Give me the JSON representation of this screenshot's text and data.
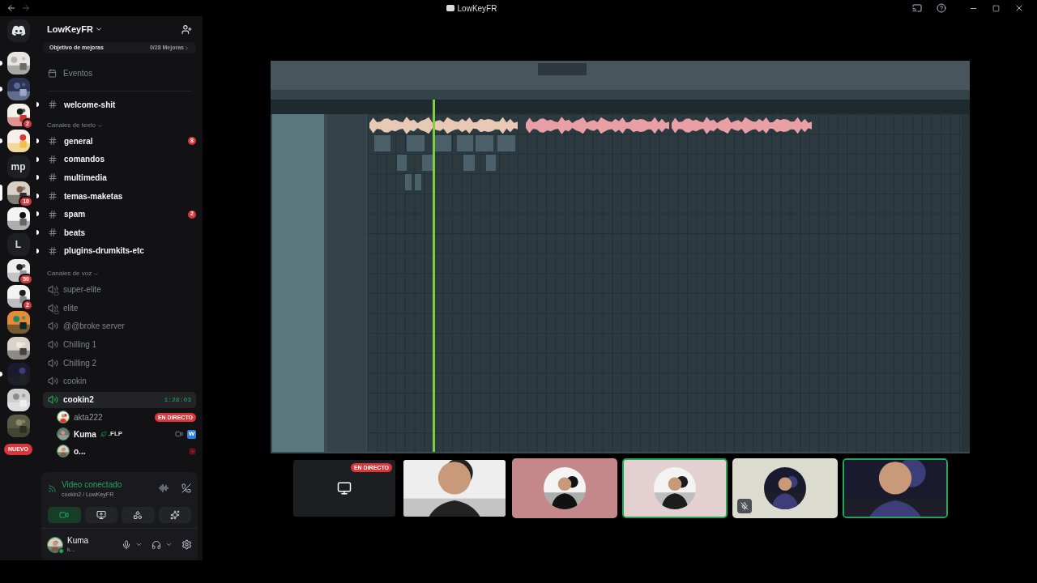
{
  "titlebar": {
    "title": "LowKeyFR"
  },
  "servers": [
    {
      "kind": "picture",
      "unread": true,
      "selected": false
    },
    {
      "kind": "picture",
      "unread": true,
      "selected": false
    },
    {
      "kind": "picture",
      "unread": false,
      "selected": false,
      "badge": "2"
    },
    {
      "kind": "picture",
      "unread": true,
      "selected": false
    },
    {
      "kind": "text",
      "label": "mp",
      "unread": false,
      "selected": false
    },
    {
      "kind": "picture",
      "unread": false,
      "selected": true,
      "badge": "10"
    },
    {
      "kind": "picture",
      "unread": false,
      "selected": false
    },
    {
      "kind": "text",
      "label": "L",
      "unread": false,
      "selected": false
    },
    {
      "kind": "picture",
      "unread": false,
      "selected": false,
      "badge": "50"
    },
    {
      "kind": "picture",
      "unread": false,
      "selected": false,
      "badge": "2"
    },
    {
      "kind": "picture",
      "unread": false,
      "selected": false
    },
    {
      "kind": "picture",
      "unread": false,
      "selected": false
    },
    {
      "kind": "picture",
      "unread": true,
      "selected": false
    },
    {
      "kind": "picture",
      "unread": false,
      "selected": false
    },
    {
      "kind": "picture",
      "unread": false,
      "selected": false
    }
  ],
  "new_badge": "NUEVO",
  "server": {
    "name": "LowKeyFR",
    "boost_label": "Objetivo de mejoras",
    "boost_progress": "0/28 Mejoras"
  },
  "events": "Eventos",
  "top_channels": [
    {
      "name": "welcome-shit",
      "unread": true
    }
  ],
  "categories": [
    {
      "name": "Canales de texto",
      "kind": "text",
      "channels": [
        {
          "name": "general",
          "unread": true,
          "badge": "8"
        },
        {
          "name": "comandos",
          "unread": true
        },
        {
          "name": "multimedia",
          "unread": true
        },
        {
          "name": "temas-maketas",
          "unread": true
        },
        {
          "name": "spam",
          "unread": true,
          "badge": "2"
        },
        {
          "name": "beats",
          "unread": true
        },
        {
          "name": "plugins-drumkits-etc",
          "unread": true
        }
      ]
    },
    {
      "name": "Canales de voz",
      "kind": "voice",
      "channels": [
        {
          "name": "super-elite",
          "selected": false,
          "locked": true
        },
        {
          "name": "elite",
          "selected": false,
          "locked": true
        },
        {
          "name": "@@broke server",
          "selected": false,
          "locked": false
        },
        {
          "name": "Chilling 1",
          "selected": false,
          "locked": false
        },
        {
          "name": "Chilling 2",
          "selected": false,
          "locked": false
        },
        {
          "name": "cookin",
          "selected": false,
          "locked": false
        },
        {
          "name": "cookin2",
          "selected": true,
          "locked": false,
          "timer": "1:28:03",
          "members": [
            {
              "name": "akta222",
              "kind": "streaming",
              "live": "EN DIRECTO"
            },
            {
              "name": "Kuma",
              "kind": "camera",
              "tag": ".FLP",
              "app_letter": "W"
            },
            {
              "name": "o...",
              "kind": "status"
            }
          ]
        }
      ]
    }
  ],
  "voice_panel": {
    "status": "Video conectado",
    "channel": "cookin2 / LowKeyFR",
    "buttons": [
      {
        "kind": "camera",
        "on": true
      },
      {
        "kind": "screen",
        "on": false
      },
      {
        "kind": "activities",
        "on": false
      },
      {
        "kind": "soundboard",
        "on": false
      }
    ]
  },
  "user": {
    "name": "Kuma",
    "status": "k..."
  },
  "tiles": [
    {
      "kind": "stream",
      "live": "EN DIRECTO",
      "speaking": false,
      "muted": false
    },
    {
      "kind": "camera",
      "speaking": false,
      "muted": false
    },
    {
      "kind": "avatar",
      "color": "#c4888b",
      "speaking": false,
      "muted": false
    },
    {
      "kind": "avatar",
      "color": "#e3d1d1",
      "speaking": true,
      "muted": false
    },
    {
      "kind": "avatar",
      "color": "#dcdbd0",
      "speaking": false,
      "muted": true
    },
    {
      "kind": "camera",
      "speaking": true,
      "muted": false
    }
  ]
}
